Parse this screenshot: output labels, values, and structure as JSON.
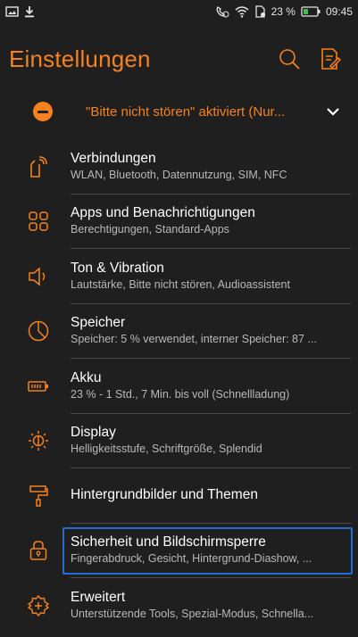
{
  "status_bar": {
    "battery_percent": "23 %",
    "time": "09:45",
    "icons": [
      "image-icon",
      "download-icon",
      "call-icon",
      "wifi-icon",
      "sim-icon",
      "battery-icon"
    ]
  },
  "header": {
    "title": "Einstellungen",
    "icons": [
      "search-icon",
      "edit-notes-icon"
    ]
  },
  "dnd_banner": {
    "text": "\"Bitte nicht stören\" aktiviert (Nur...",
    "icon": "do-not-disturb-icon",
    "chevron": "chevron-down-icon"
  },
  "settings": [
    {
      "title": "Verbindungen",
      "subtitle": "WLAN, Bluetooth, Datennutzung, SIM, NFC",
      "icon": "connections-icon"
    },
    {
      "title": "Apps und Benachrichtigungen",
      "subtitle": "Berechtigungen, Standard-Apps",
      "icon": "apps-icon"
    },
    {
      "title": "Ton & Vibration",
      "subtitle": "Lautstärke, Bitte nicht stören, Audioassistent",
      "icon": "speaker-icon"
    },
    {
      "title": "Speicher",
      "subtitle": "Speicher: 5 % verwendet, interner Speicher: 87 ...",
      "icon": "storage-pie-icon"
    },
    {
      "title": "Akku",
      "subtitle": "23 % - 1 Std., 7 Min. bis voll (Schnellladung)",
      "icon": "battery-icon"
    },
    {
      "title": "Display",
      "subtitle": "Helligkeitsstufe, Schriftgröße, Splendid",
      "icon": "brightness-icon"
    },
    {
      "title": "Hintergrundbilder und Themen",
      "subtitle": "",
      "icon": "paint-roller-icon"
    },
    {
      "title": "Sicherheit und Bildschirmsperre",
      "subtitle": "Fingerabdruck, Gesicht, Hintergrund-Diashow, ...",
      "icon": "lock-icon",
      "selected": true
    },
    {
      "title": "Erweitert",
      "subtitle": "Unterstützende Tools, Spezial-Modus, Schnella...",
      "icon": "advanced-gear-icon"
    }
  ],
  "colors": {
    "background": "#1f1f1f",
    "accent": "#f5821f",
    "focus": "#1e6fd0",
    "subtitle": "#b8b8b8",
    "divider": "#4a4a4a"
  }
}
